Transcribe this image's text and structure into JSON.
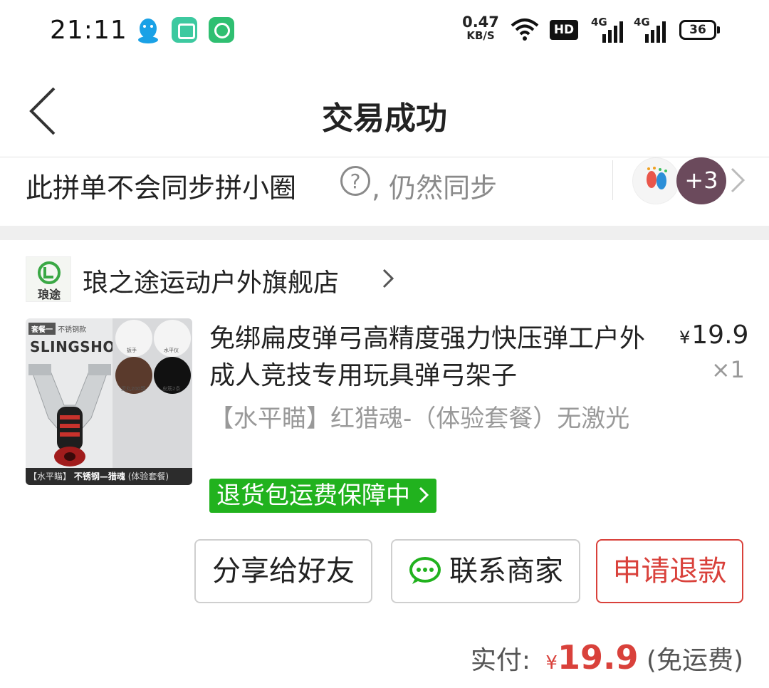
{
  "status_bar": {
    "time": "21:11",
    "net_speed_value": "0.47",
    "net_speed_unit": "KB/S",
    "hd_label": "HD",
    "signal1_label": "4G",
    "signal2_label": "4G",
    "battery": "36",
    "icons": [
      "qq-icon",
      "message-icon",
      "clock-app-icon",
      "wifi-icon",
      "hd-icon",
      "signal-icon",
      "battery-icon"
    ]
  },
  "header": {
    "title": "交易成功",
    "back_icon": "chevron-left-icon"
  },
  "sync_bar": {
    "text": "此拼单不会同步拼小圈",
    "help_icon": "?",
    "still_sync": ", 仍然同步",
    "avatar_more": "+3"
  },
  "store": {
    "name": "琅之途运动户外旗舰店",
    "logo_text": "琅途"
  },
  "product": {
    "title": "免绑扁皮弹弓高精度强力快压弹工户外成人竞技专用玩具弹弓架子",
    "price_symbol": "¥",
    "price": "19.9",
    "quantity": "×1",
    "spec": "【水平瞄】红猎魂-（体验套餐）无激光",
    "return_badge": "退货包运费保障中",
    "image": {
      "tag": "套餐一",
      "tag_note": "不锈钢款",
      "brand": "SLINGSHOT",
      "caption_bottom_prefix": "【水平瞄】",
      "caption_bottom_main": "不锈钢—猎魂",
      "caption_bottom_suffix": "(体验套餐)",
      "cells": [
        "扳手",
        "水平仪",
        "泥丸200颗",
        "皮筋2条"
      ]
    }
  },
  "actions": {
    "share": "分享给好友",
    "contact": "联系商家",
    "refund": "申请退款"
  },
  "total": {
    "label": "实付:",
    "symbol": "¥",
    "amount": "19.9",
    "note": "(免运费)"
  },
  "colors": {
    "accent_red": "#d9413b",
    "badge_green": "#21b21e",
    "muted_gray": "#999999"
  }
}
